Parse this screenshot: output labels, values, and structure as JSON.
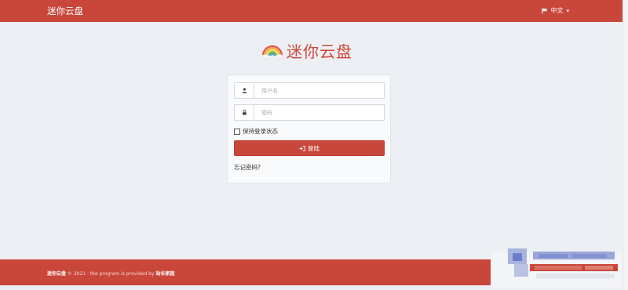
{
  "navbar": {
    "brand": "迷你云盘",
    "language": "中文"
  },
  "logo": {
    "title": "迷你云盘",
    "icon": "rainbow-cloud-icon"
  },
  "login_form": {
    "username_placeholder": "用户名",
    "password_placeholder": "密码",
    "remember_label": "保持登录状态",
    "login_button": "登陆",
    "forgot_link": "忘记密码?"
  },
  "footer": {
    "brand": "迷你云盘",
    "copyright": " © 2021 · the program is provided by ",
    "provider": "站长家园"
  },
  "colors": {
    "brand_red": "#c9473a",
    "page_bg": "#eceff3"
  }
}
